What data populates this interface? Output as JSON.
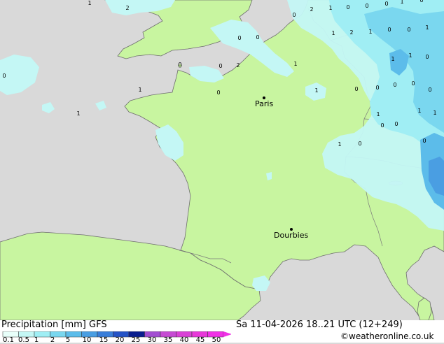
{
  "map": {
    "cities": [
      {
        "name": "Paris"
      },
      {
        "name": "Dourbies"
      }
    ],
    "precip_labels": [
      "2",
      "1",
      "0",
      "0",
      "0",
      "1",
      "0",
      "0",
      "1",
      "2",
      "1",
      "0",
      "0",
      "1",
      "1",
      "2",
      "0",
      "0",
      "0",
      "1",
      "1",
      "0",
      "0",
      "0",
      "2",
      "1",
      "0",
      "0",
      "0",
      "0",
      "0",
      "1",
      "1",
      "0",
      "1",
      "1",
      "1",
      "1",
      "0",
      "0",
      "0",
      "1",
      "0"
    ]
  },
  "footer": {
    "title": "Precipitation [mm]  GFS",
    "datetime": "Sa 11-04-2026 18..21 UTC (12+249)",
    "copyright": "©weatheronline.co.uk",
    "scale_values": [
      "0.1",
      "0.5",
      "1",
      "2",
      "5",
      "10",
      "15",
      "20",
      "25",
      "30",
      "35",
      "40",
      "45",
      "50"
    ],
    "scale_colors": [
      "#e8fffa",
      "#c4f7f5",
      "#a0eef4",
      "#7ad7ef",
      "#5cbcea",
      "#4a9ee2",
      "#3a7ed9",
      "#2553c6",
      "#0a1e8f",
      "#a24ed1",
      "#c64bd3",
      "#d941d6",
      "#e838d9",
      "#f030e6"
    ]
  },
  "colors": {
    "land": "#c8f5a0",
    "sea": "#d9d9d9",
    "precip_light": "#c4f7f5",
    "precip_mid": "#a0eef4",
    "precip_heavy": "#5cbcea"
  }
}
